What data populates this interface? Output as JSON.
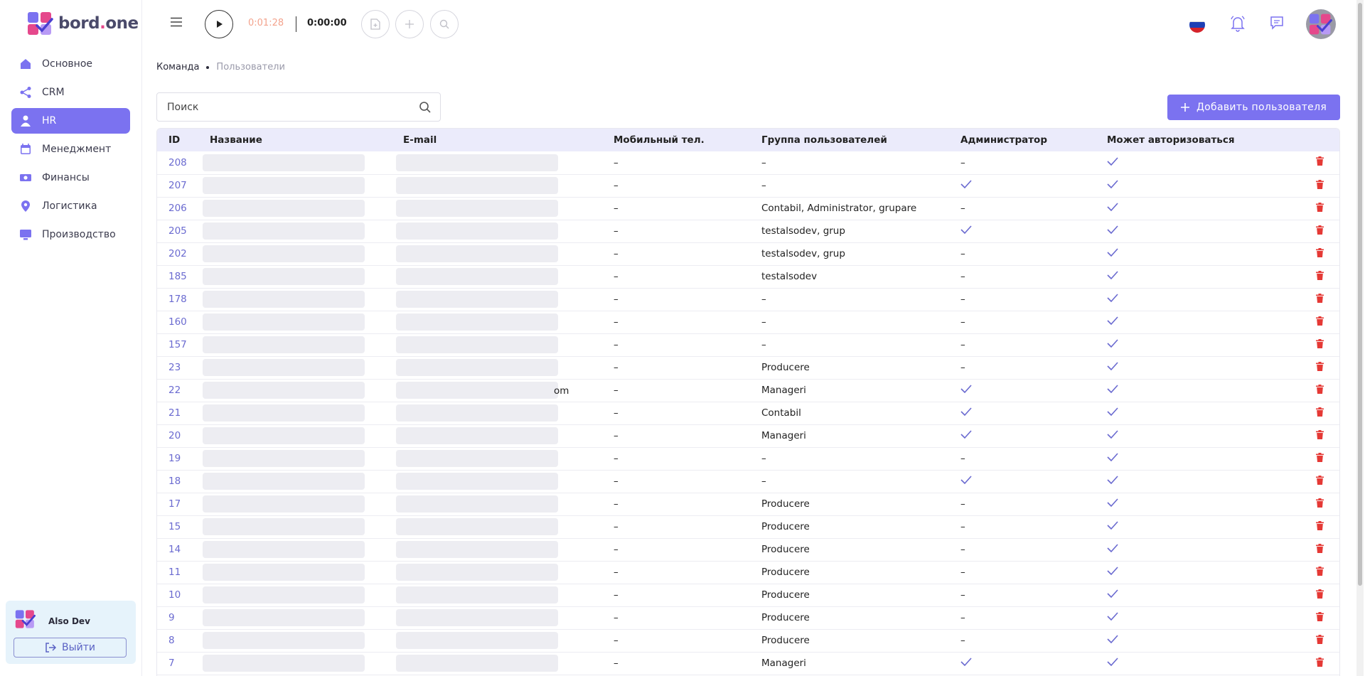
{
  "app": {
    "logo_text_main": "bord",
    "logo_text_dot": ".",
    "logo_text_end": "one"
  },
  "sidebar": {
    "items": [
      {
        "label": "Основное",
        "icon": "home-icon",
        "active": false
      },
      {
        "label": "CRM",
        "icon": "share-icon",
        "active": false
      },
      {
        "label": "HR",
        "icon": "person-icon",
        "active": true
      },
      {
        "label": "Менеджмент",
        "icon": "calendar-icon",
        "active": false
      },
      {
        "label": "Финансы",
        "icon": "money-icon",
        "active": false
      },
      {
        "label": "Логистика",
        "icon": "location-icon",
        "active": false
      },
      {
        "label": "Производство",
        "icon": "monitor-icon",
        "active": false
      }
    ],
    "user_name": "Also Dev",
    "logout_label": "Выйти"
  },
  "topbar": {
    "timer_elapsed": "0:01:28",
    "timer_total": "0:00:00"
  },
  "breadcrumb": {
    "first": "Команда",
    "second": "Пользователи"
  },
  "search": {
    "placeholder": "Поиск"
  },
  "add_button_label": "Добавить пользователя",
  "table": {
    "headers": [
      "ID",
      "Название",
      "E-mail",
      "Мобильный тел.",
      "Группа пользователей",
      "Администратор",
      "Может авторизоваться"
    ],
    "rows": [
      {
        "id": "208",
        "email_tail": "",
        "phone": "–",
        "group": "–",
        "admin": false,
        "can_login": true
      },
      {
        "id": "207",
        "email_tail": "",
        "phone": "–",
        "group": "–",
        "admin": true,
        "can_login": true
      },
      {
        "id": "206",
        "email_tail": "",
        "phone": "–",
        "group": "Contabil, Administrator, grupare",
        "admin": false,
        "can_login": true
      },
      {
        "id": "205",
        "email_tail": "",
        "phone": "–",
        "group": "testalsodev, grup",
        "admin": true,
        "can_login": true
      },
      {
        "id": "202",
        "email_tail": "",
        "phone": "–",
        "group": "testalsodev, grup",
        "admin": false,
        "can_login": true
      },
      {
        "id": "185",
        "email_tail": "",
        "phone": "–",
        "group": "testalsodev",
        "admin": false,
        "can_login": true
      },
      {
        "id": "178",
        "email_tail": "",
        "phone": "–",
        "group": "–",
        "admin": false,
        "can_login": true
      },
      {
        "id": "160",
        "email_tail": "",
        "phone": "–",
        "group": "–",
        "admin": false,
        "can_login": true
      },
      {
        "id": "157",
        "email_tail": "",
        "phone": "–",
        "group": "–",
        "admin": false,
        "can_login": true
      },
      {
        "id": "23",
        "email_tail": "",
        "phone": "–",
        "group": "Producere",
        "admin": false,
        "can_login": true
      },
      {
        "id": "22",
        "email_tail": "om",
        "phone": "–",
        "group": "Manageri",
        "admin": true,
        "can_login": true
      },
      {
        "id": "21",
        "email_tail": "",
        "phone": "–",
        "group": "Contabil",
        "admin": true,
        "can_login": true
      },
      {
        "id": "20",
        "email_tail": "",
        "phone": "–",
        "group": "Manageri",
        "admin": true,
        "can_login": true
      },
      {
        "id": "19",
        "email_tail": "",
        "phone": "–",
        "group": "–",
        "admin": false,
        "can_login": true
      },
      {
        "id": "18",
        "email_tail": "",
        "phone": "–",
        "group": "–",
        "admin": true,
        "can_login": true
      },
      {
        "id": "17",
        "email_tail": "",
        "phone": "–",
        "group": "Producere",
        "admin": false,
        "can_login": true
      },
      {
        "id": "15",
        "email_tail": "",
        "phone": "–",
        "group": "Producere",
        "admin": false,
        "can_login": true
      },
      {
        "id": "14",
        "email_tail": "",
        "phone": "–",
        "group": "Producere",
        "admin": false,
        "can_login": true
      },
      {
        "id": "11",
        "email_tail": "",
        "phone": "–",
        "group": "Producere",
        "admin": false,
        "can_login": true
      },
      {
        "id": "10",
        "email_tail": "",
        "phone": "–",
        "group": "Producere",
        "admin": false,
        "can_login": true
      },
      {
        "id": "9",
        "email_tail": "",
        "phone": "–",
        "group": "Producere",
        "admin": false,
        "can_login": true
      },
      {
        "id": "8",
        "email_tail": "",
        "phone": "–",
        "group": "Producere",
        "admin": false,
        "can_login": true
      },
      {
        "id": "7",
        "email_tail": "",
        "phone": "–",
        "group": "Manageri",
        "admin": true,
        "can_login": true
      }
    ],
    "dash": "–"
  },
  "colors": {
    "accent": "#7b72f0",
    "check": "#6a6ad0",
    "delete": "#e53935",
    "timer_elapsed": "#f3a38d"
  }
}
